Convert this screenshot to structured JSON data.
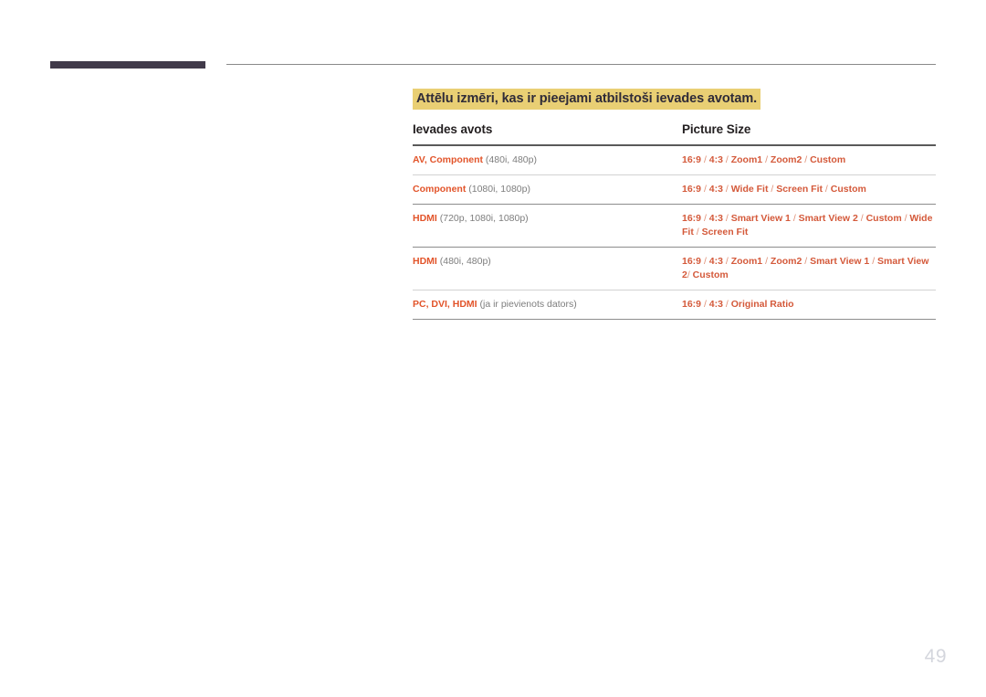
{
  "document": {
    "page_number": "49",
    "section_title": "Attēlu izmēri, kas ir pieejami atbilstoši ievades avotam.",
    "colors": {
      "highlight": "#e9cf74",
      "title_text": "#2f2b38",
      "header_bar": "#413a4a",
      "accent_orange": "#e2542a",
      "size_text": "#d4593a",
      "muted_gray": "#7d7d7d",
      "page_number": "#d4d6dd"
    }
  },
  "table": {
    "headers": {
      "source": "Ievades avots",
      "picture_size": "Picture Size"
    },
    "rows": [
      {
        "source_name": "AV, Component",
        "source_resolution": "(480i, 480p)",
        "picture_size": "16:9 / 4:3 / Zoom1 / Zoom2 / Custom"
      },
      {
        "source_name": "Component",
        "source_resolution": "(1080i, 1080p)",
        "picture_size": "16:9 / 4:3 / Wide Fit / Screen Fit / Custom"
      },
      {
        "source_name": "HDMI",
        "source_resolution": "(720p, 1080i, 1080p)",
        "picture_size": "16:9 / 4:3 / Smart View 1 / Smart View 2 / Custom / Wide Fit / Screen Fit"
      },
      {
        "source_name": "HDMI",
        "source_resolution": "(480i, 480p)",
        "picture_size": "16:9 / 4:3 / Zoom1 / Zoom2 / Smart View 1 / Smart View 2/ Custom"
      },
      {
        "source_name": "PC, DVI, HDMI",
        "source_resolution": "(ja ir pievienots dators)",
        "picture_size": "16:9 / 4:3 / Original Ratio"
      }
    ]
  }
}
